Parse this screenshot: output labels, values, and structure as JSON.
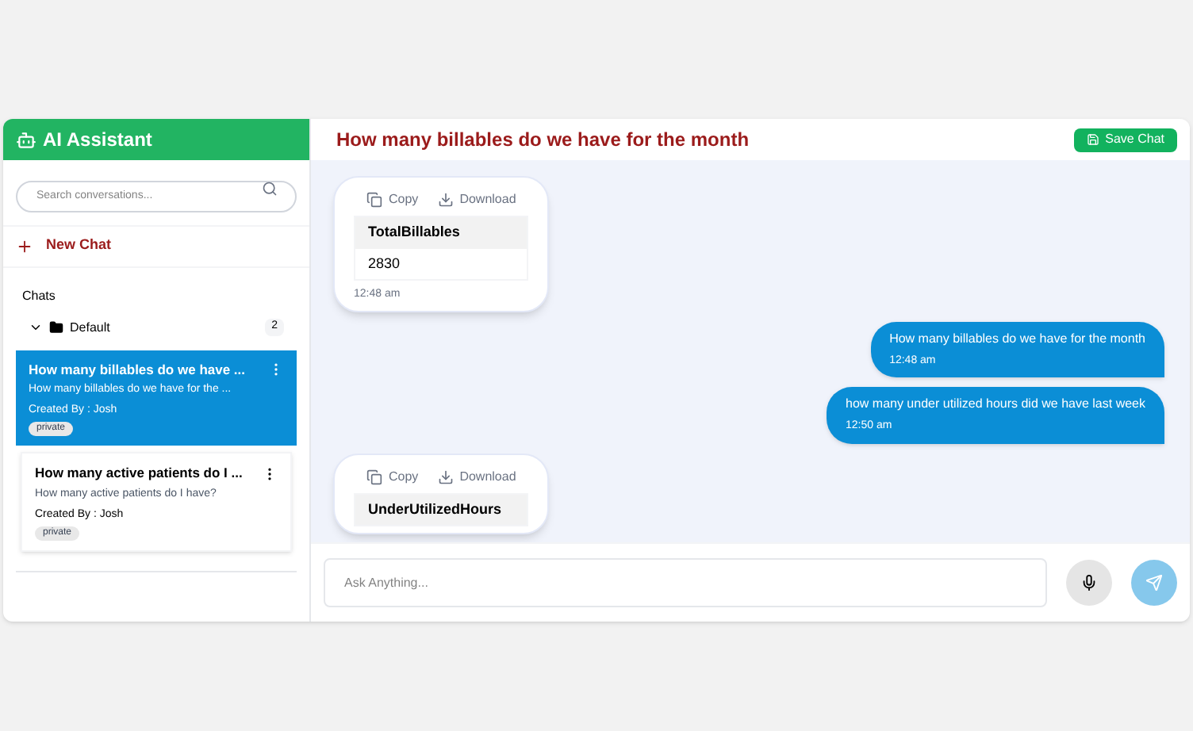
{
  "sidebar": {
    "title": "AI Assistant",
    "search": {
      "placeholder": "Search conversations..."
    },
    "new_chat": "New Chat",
    "section": "Chats",
    "folder": {
      "name": "Default",
      "count": "2",
      "expanded": true,
      "items": [
        {
          "title": "How many billables do we have ...",
          "preview": "How many billables do we have for the ...",
          "author": "Created By : Josh",
          "tag": "private",
          "selected": true
        },
        {
          "title": "How many active patients do I ...",
          "preview": "How many active patients do I have?",
          "author": "Created By : Josh",
          "tag": "private",
          "selected": false
        }
      ]
    }
  },
  "chat": {
    "title": "How many billables do we have for the month",
    "save_button": "Save Chat",
    "messages": [
      {
        "kind": "bot",
        "copy": "Copy",
        "download": "Download",
        "column": "TotalBillables",
        "value": "2830",
        "time": "12:48 am"
      },
      {
        "kind": "user",
        "text": "How many billables do we have for the month",
        "time": "12:48 am"
      },
      {
        "kind": "user",
        "text": "how many under utilized hours did we have last week",
        "time": "12:50 am"
      },
      {
        "kind": "bot",
        "copy": "Copy",
        "download": "Download",
        "column": "UnderUtilizedHours"
      }
    ],
    "input": {
      "placeholder": "Ask Anything..."
    }
  }
}
